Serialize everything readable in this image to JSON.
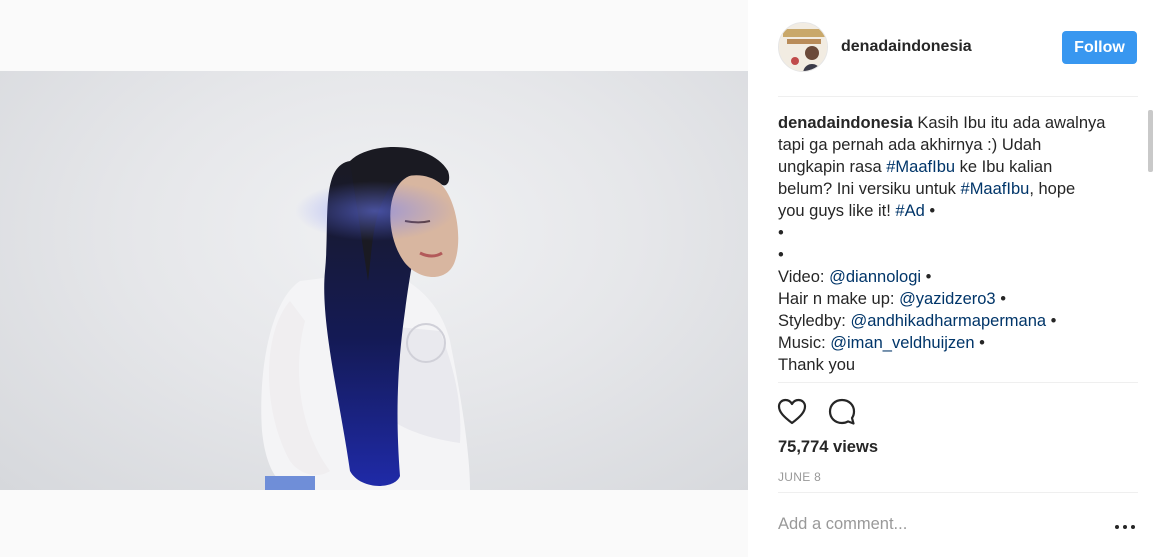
{
  "post": {
    "username": "denadaindonesia",
    "follow_label": "Follow",
    "caption": {
      "username": "denadaindonesia",
      "lines": [
        {
          "text": "Kasih Ibu itu ada awalnya"
        },
        {
          "text": "tapi ga pernah ada akhirnya :) Udah"
        },
        {
          "pre": "ungkapin rasa ",
          "link": "#MaafIbu",
          "post": " ke Ibu kalian"
        },
        {
          "pre": "belum? Ini versiku untuk ",
          "link": "#MaafIbu",
          "post": ", hope"
        },
        {
          "pre": "you guys like it! ",
          "link": "#Ad",
          "post": " •"
        },
        {
          "text": "•"
        },
        {
          "text": "•"
        },
        {
          "pre": "Video: ",
          "link": "@diannologi",
          "post": " •"
        },
        {
          "pre": "Hair n make up: ",
          "link": "@yazidzero3",
          "post": " •"
        },
        {
          "pre": "Styledby: ",
          "link": "@andhikadharmapermana",
          "post": " •"
        },
        {
          "pre": "Music: ",
          "link": "@iman_veldhuijzen",
          "post": " •"
        },
        {
          "text": "Thank you"
        }
      ]
    },
    "views": "75,774 views",
    "date": "JUNE 8",
    "comment_placeholder": "Add a comment..."
  },
  "icons": {
    "avatar": "profile-avatar",
    "like": "heart-icon",
    "comment": "comment-icon",
    "more": "more-options-icon"
  },
  "colors": {
    "follow_button": "#3897f0",
    "link": "#003569",
    "divider": "#efefef",
    "meta_text": "#999999"
  }
}
